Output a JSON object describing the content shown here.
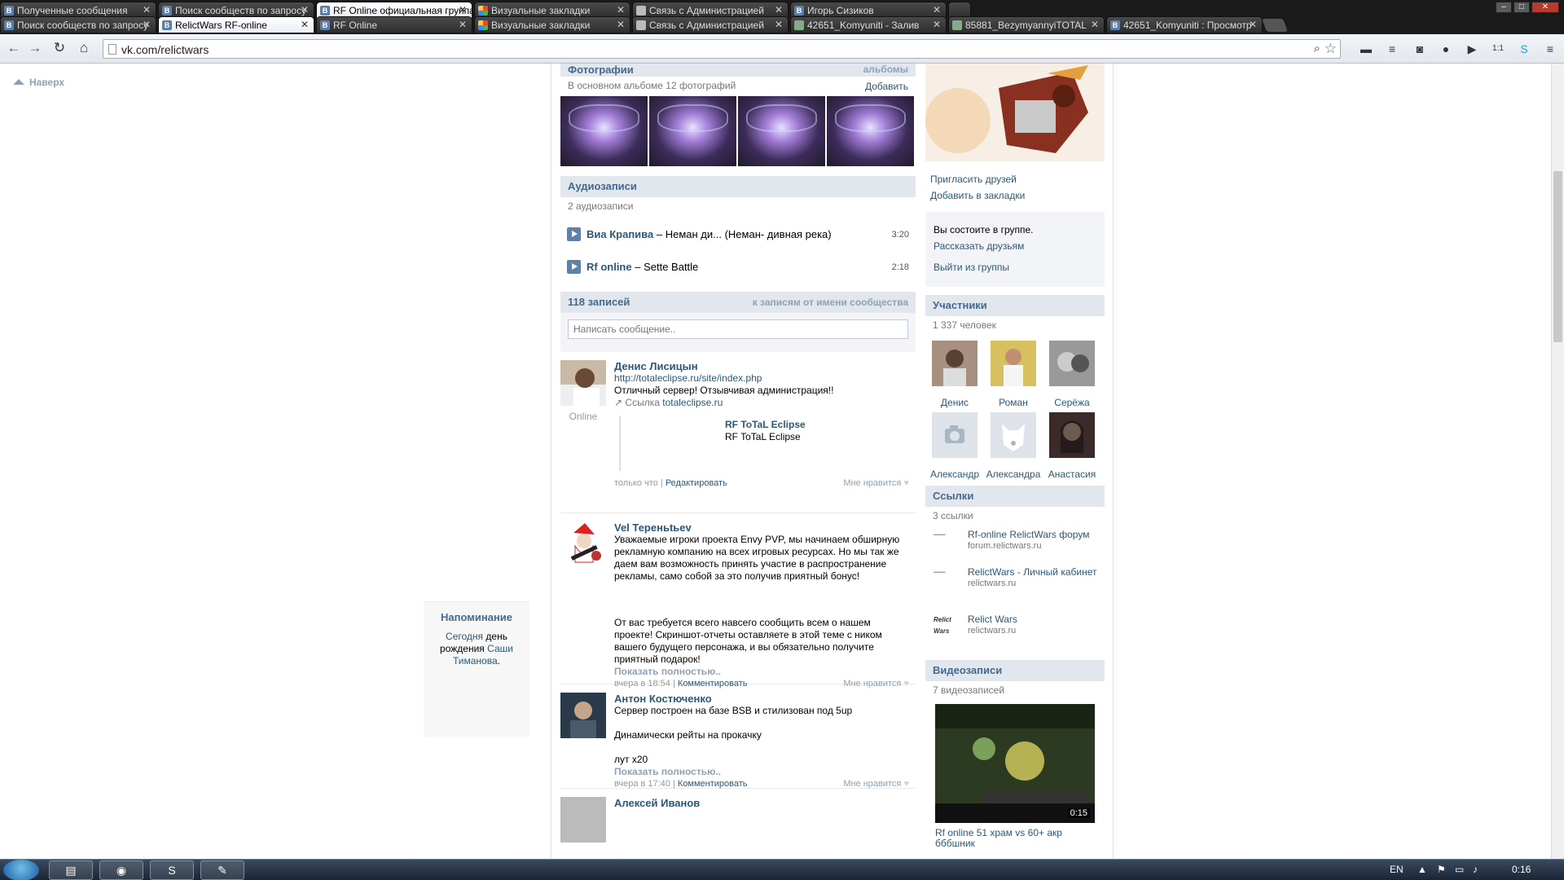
{
  "browser": {
    "tabs_row1": [
      {
        "title": "Полученные сообщения",
        "icon": "vk-icon"
      },
      {
        "title": "Поиск сообществ по запросу",
        "icon": "vk-icon"
      },
      {
        "title": "RF Online официальная группа",
        "icon": "vk-icon",
        "active": true
      },
      {
        "title": "Визуальные закладки",
        "icon": "grid-icon"
      },
      {
        "title": "Связь с Администрацией",
        "icon": "doc-icon"
      },
      {
        "title": "Игорь Сизиков",
        "icon": "vk-icon"
      },
      {
        "title": ""
      }
    ],
    "tabs_row2": [
      {
        "title": "Поиск сообществ по запросу",
        "icon": "vk-icon"
      },
      {
        "title": "RelictWars RF-online",
        "icon": "vk-icon",
        "active": true
      },
      {
        "title": "RF Online",
        "icon": "vk-icon"
      },
      {
        "title": "Визуальные закладки",
        "icon": "grid-icon"
      },
      {
        "title": "Связь с Администрацией",
        "icon": "doc-icon"
      },
      {
        "title": "42651_Komyuniti - Залив",
        "icon": "image-icon"
      },
      {
        "title": "85881_BezymyannyiTOTAL",
        "icon": "image-icon"
      },
      {
        "title": "42651_Komyuniti : Просмотр",
        "icon": "vk-icon"
      }
    ],
    "url": "vk.com/relictwars"
  },
  "page": {
    "to_top": "Наверх",
    "reminder": {
      "title": "Напоминание",
      "today": "Сегодня",
      "text": "день рождения",
      "name": "Саши Тиманова",
      "dot": "."
    },
    "photos": {
      "title": "Фотографии",
      "albums_link": "альбомы",
      "subtitle": "В основном альбоме 12 фотографий",
      "add_link": "Добавить"
    },
    "audio": {
      "title": "Аудиозаписи",
      "subtitle": "2 аудиозаписи",
      "tracks": [
        {
          "artist": "Виа Крапива",
          "sep": " – ",
          "title": "Неман ди... (Неман- дивная река)",
          "duration": "3:20"
        },
        {
          "artist": "Rf online",
          "sep": " – ",
          "title": "Sette Battle",
          "duration": "2:18"
        }
      ]
    },
    "wall": {
      "title": "118 записей",
      "community_link": "к записям от имени сообщества",
      "placeholder": "Написать сообщение..",
      "posts": [
        {
          "author": "Денис Лисицын",
          "online": "Online",
          "link": "http://totaleclipse.ru/site/index.php",
          "text": "Отличный сервер! Отзывчивая администрация!!",
          "link_label": "Ссылка",
          "link_domain": "totaleclipse.ru",
          "card_title": "RF ToTaL Eclipse",
          "card_desc": "RF ToTaL Eclipse",
          "time": "только что",
          "action": "Редактировать",
          "like": "Мне нравится"
        },
        {
          "author": "Vel Тереньtьev",
          "text1": "Уважаемые игроки проекта Envy PVP, мы начинаем обширную рекламную компанию на всех игровых ресурсах. Но мы так же даем вам возможность принять участие в распространение рекламы, само собой за это получив приятный бонус!",
          "text2": "От вас требуется всего навсего сообщить всем о нашем проекте! Скриншот-отчеты оставляете в этой теме с ником вашего будущего персонажа, и вы обязательно получите приятный подарок!",
          "show_all": "Показать полностью..",
          "time": "вчера в 18:54",
          "action": "Комментировать",
          "like": "Мне нравится"
        },
        {
          "author": "Антон Костюченко",
          "line1": "Сервер построен на базе BSB и стилизован под 5up",
          "line2": "Динамически рейты на прокачку",
          "line3": "лут х20",
          "show_all": "Показать полностью..",
          "time": "вчера в 17:40",
          "action": "Комментировать",
          "like": "Мне нравится"
        },
        {
          "author": "Алексей Иванов"
        }
      ]
    },
    "right": {
      "invite": "Пригласить друзей",
      "bookmark": "Добавить в закладки",
      "membership": "Вы состоите в группе.",
      "tell_friends": "Рассказать друзьям",
      "leave": "Выйти из группы",
      "members_title": "Участники",
      "members_count": "1 337 человек",
      "members": [
        "Денис",
        "Роман",
        "Серёжа",
        "Александр",
        "Александра",
        "Анастасия"
      ],
      "links_title": "Ссылки",
      "links_count": "3 ссылки",
      "links": [
        {
          "title": "Rf-online RelictWars форум",
          "domain": "forum.relictwars.ru"
        },
        {
          "title": "RelictWars - Личный кабинет",
          "domain": "relictwars.ru"
        },
        {
          "title": "Relict Wars",
          "domain": "relictwars.ru",
          "logo_text": "Relict Wars"
        }
      ],
      "videos_title": "Видеозаписи",
      "videos_count": "7 видеозаписей",
      "video_duration": "0:15",
      "video_title": "Rf online 51 храм vs 60+ акр бббшник"
    }
  },
  "taskbar": {
    "lang": "EN",
    "clock": "0:16"
  },
  "colors": {
    "vk_link": "#2b587a",
    "vk_header_bg": "#e1e7ed",
    "vk_header_text": "#45688e",
    "muted": "#8ea1b6"
  }
}
